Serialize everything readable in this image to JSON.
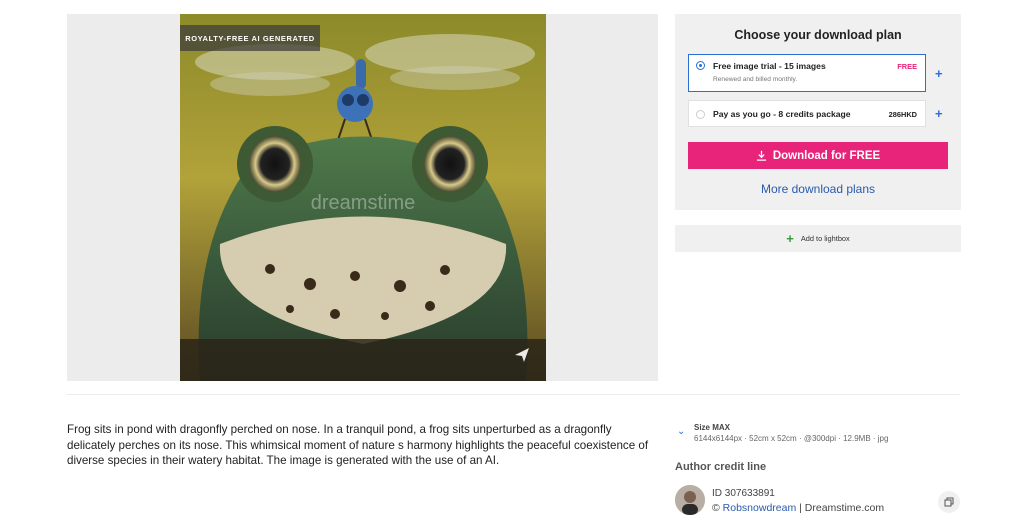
{
  "image": {
    "badge": "ROYALTY-FREE AI GENERATED",
    "watermark": "dreamstime"
  },
  "plans": {
    "title": "Choose your download plan",
    "options": [
      {
        "name": "Free image trial - 15 images",
        "sub": "Renewed and billed monthly.",
        "price": "FREE",
        "price_color": "#e8237a",
        "selected": true
      },
      {
        "name": "Pay as you go - 8 credits package",
        "sub": "",
        "price": "286HKD",
        "price_color": "#222222",
        "selected": false
      }
    ],
    "download_label": "Download for FREE",
    "more_plans": "More download plans"
  },
  "lightbox": {
    "label": "Add to lightbox"
  },
  "description": "Frog sits in pond with dragonfly perched on nose. In a tranquil pond, a frog sits unperturbed as a dragonfly delicately perches on its nose. This whimsical moment of nature s harmony highlights the peaceful coexistence of diverse species in their watery habitat. The image is generated with the use of an AI.",
  "details": {
    "size_label": "Size MAX",
    "size_info": "6144x6144px · 52cm x 52cm · @300dpi · 12.9MB · jpg",
    "credit_heading": "Author credit line",
    "id": "ID 307633891",
    "copyright_symbol": "©",
    "author": "Robsnowdream",
    "site": "| Dreamstime.com"
  },
  "colors": {
    "accent": "#e8237a",
    "link": "#2a5bab",
    "select_blue": "#2a6fd6"
  },
  "icons": {
    "download": "download-icon",
    "plus": "plus-icon",
    "chevron": "chevron-down-icon",
    "share": "share-icon",
    "copy": "copy-icon"
  }
}
